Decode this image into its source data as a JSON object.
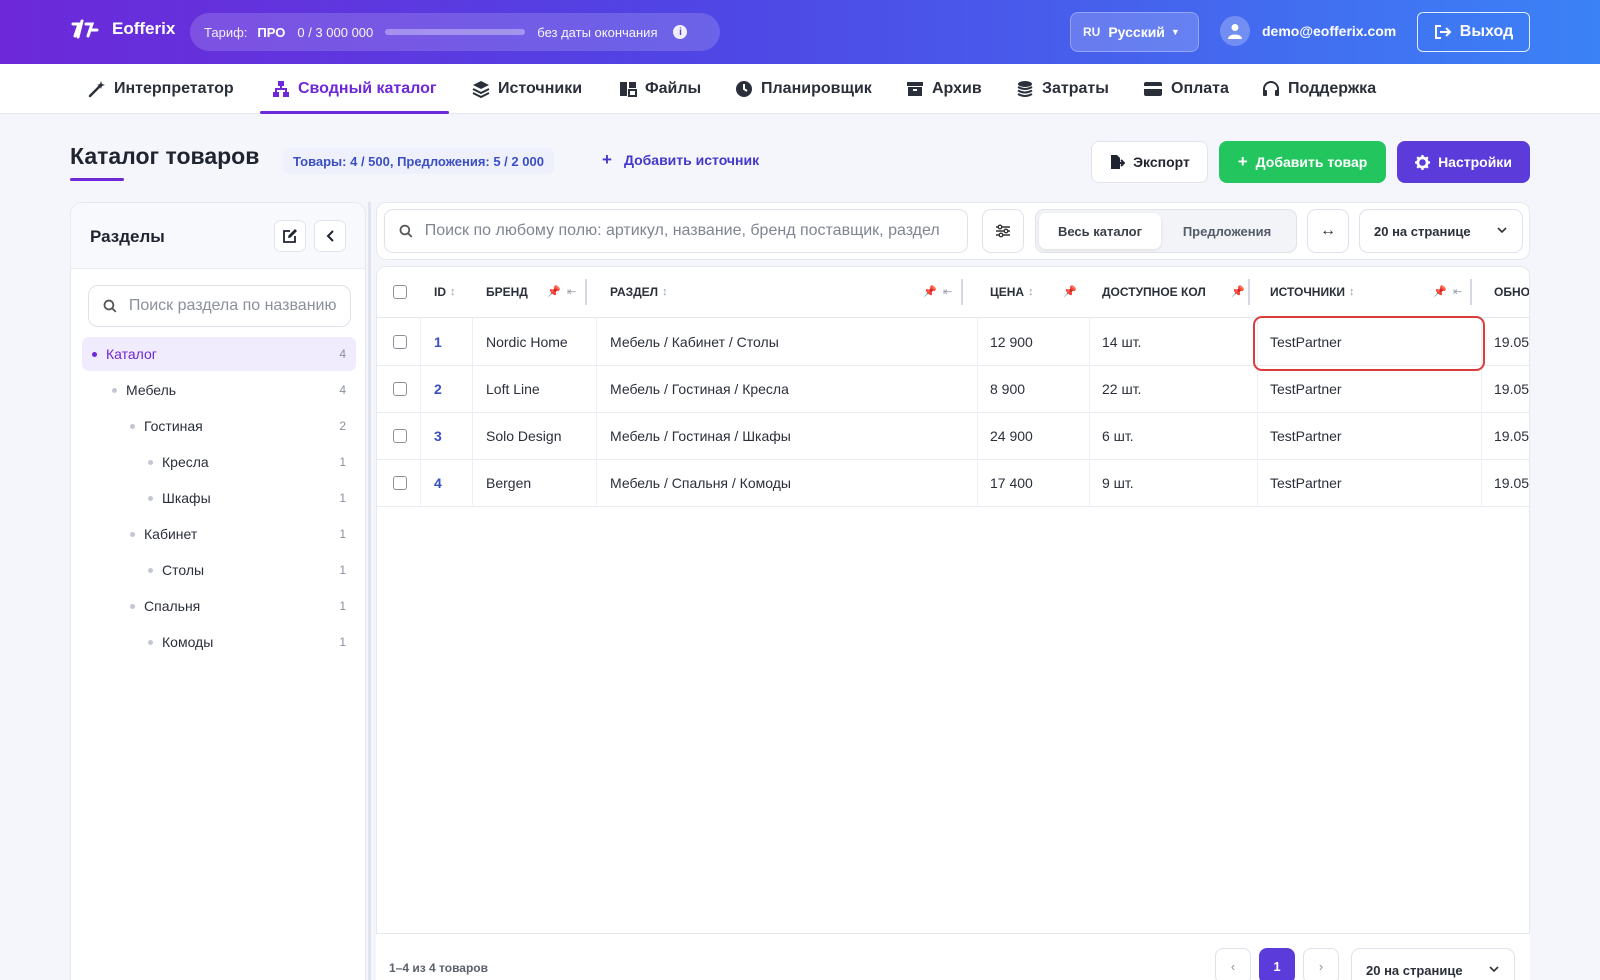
{
  "app": {
    "name": "Eofferix"
  },
  "tariff": {
    "label": "Тариф:",
    "plan": "ПРО",
    "usage": "0  /  3 000 000",
    "progress": 0,
    "no_end": "без даты окончания"
  },
  "lang": {
    "code": "RU",
    "name": "Русский"
  },
  "user": {
    "email": "demo@eofferix.com"
  },
  "logout_label": "Выход",
  "nav": [
    {
      "label": "Интерпретатор",
      "icon": "magic-wand-icon"
    },
    {
      "label": "Сводный каталог",
      "icon": "sitemap-icon",
      "active": true
    },
    {
      "label": "Источники",
      "icon": "layers-icon"
    },
    {
      "label": "Файлы",
      "icon": "files-icon"
    },
    {
      "label": "Планировщик",
      "icon": "clock-icon"
    },
    {
      "label": "Архив",
      "icon": "archive-icon"
    },
    {
      "label": "Затраты",
      "icon": "coins-icon"
    },
    {
      "label": "Оплата",
      "icon": "credit-card-icon"
    },
    {
      "label": "Поддержка",
      "icon": "headset-icon"
    }
  ],
  "page": {
    "title": "Каталог товаров",
    "counts": "Товары: 4 / 500, Предложения: 5 / 2 000",
    "add_source": "Добавить источник",
    "export_label": "Экспорт",
    "add_product_label": "Добавить товар",
    "settings_label": "Настройки"
  },
  "sidebar": {
    "title": "Разделы",
    "search_placeholder": "Поиск раздела по названию",
    "tree": [
      {
        "label": "Каталог",
        "count": "4",
        "level": 0,
        "active": true
      },
      {
        "label": "Мебель",
        "count": "4",
        "level": 1
      },
      {
        "label": "Гостиная",
        "count": "2",
        "level": 2
      },
      {
        "label": "Кресла",
        "count": "1",
        "level": 3
      },
      {
        "label": "Шкафы",
        "count": "1",
        "level": 3
      },
      {
        "label": "Кабинет",
        "count": "1",
        "level": 2
      },
      {
        "label": "Столы",
        "count": "1",
        "level": 3
      },
      {
        "label": "Спальня",
        "count": "1",
        "level": 2
      },
      {
        "label": "Комоды",
        "count": "1",
        "level": 3
      }
    ]
  },
  "toolbar": {
    "search_placeholder": "Поиск по любому полю: артикул, название, бренд поставщик, раздел",
    "view_all": "Весь каталог",
    "view_offers": "Предложения",
    "per_page": "20 на странице"
  },
  "table": {
    "columns": [
      "ID",
      "БРЕНД",
      "РАЗДЕЛ",
      "ЦЕНА",
      "ДОСТУПНОЕ КОЛ",
      "ИСТОЧНИКИ",
      "ОБНО"
    ],
    "rows": [
      {
        "id": "1",
        "brand": "Nordic Home",
        "section": "Мебель / Кабинет / Столы",
        "price": "12 900",
        "qty": "14 шт.",
        "source": "TestPartner",
        "updated": "19.05"
      },
      {
        "id": "2",
        "brand": "Loft Line",
        "section": "Мебель / Гостиная / Кресла",
        "price": "8 900",
        "qty": "22 шт.",
        "source": "TestPartner",
        "updated": "19.05"
      },
      {
        "id": "3",
        "brand": "Solo Design",
        "section": "Мебель / Гостиная / Шкафы",
        "price": "24 900",
        "qty": "6 шт.",
        "source": "TestPartner",
        "updated": "19.05"
      },
      {
        "id": "4",
        "brand": "Bergen",
        "section": "Мебель / Спальня / Комоды",
        "price": "17 400",
        "qty": "9 шт.",
        "source": "TestPartner",
        "updated": "19.05"
      }
    ]
  },
  "footer": {
    "range": "1–4 из 4 товаров",
    "prev": "‹",
    "current_page": "1",
    "next": "›",
    "per_page": "20 на странице"
  },
  "colors": {
    "accent": "#6d28d9",
    "primary_button": "#5b3bd9",
    "success": "#22c55e",
    "highlight": "#dc3c3c"
  }
}
